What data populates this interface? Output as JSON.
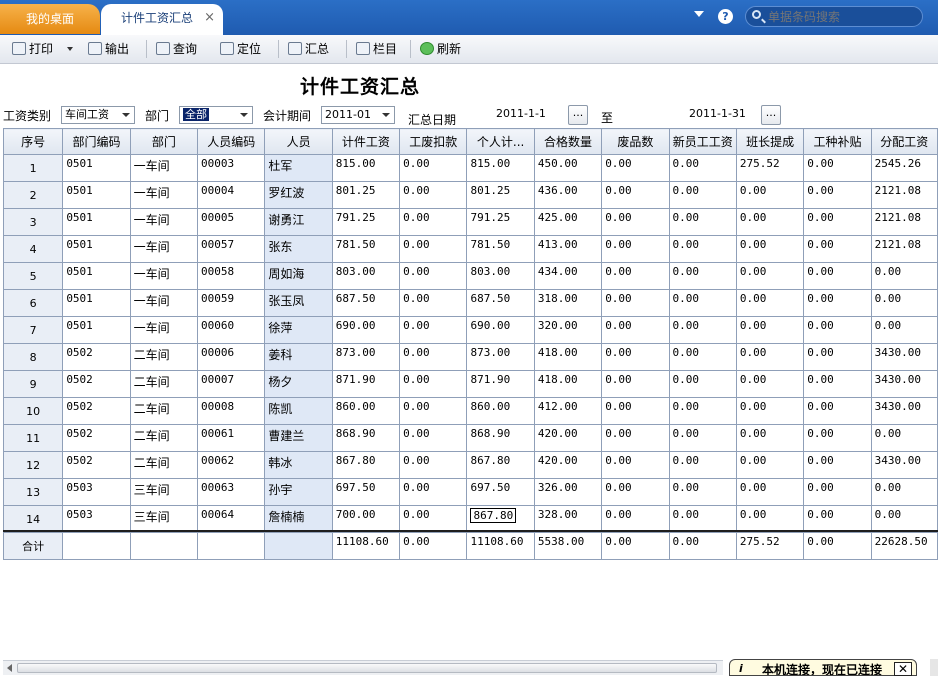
{
  "tabs": [
    {
      "label": "我的桌面"
    },
    {
      "label": "计件工资汇总",
      "close": "×"
    }
  ],
  "header": {
    "help": "?",
    "search_placeholder": "单据条码搜索"
  },
  "toolbar": {
    "print": "打印",
    "export": "输出",
    "query": "查询",
    "locate": "定位",
    "summary": "汇总",
    "columns": "栏目",
    "refresh": "刷新"
  },
  "report_title": "计件工资汇总",
  "filters": {
    "wage_type_label": "工资类别",
    "wage_type_value": "车间工资",
    "dept_label": "部门",
    "dept_value": "全部",
    "period_label": "会计期间",
    "period_value": "2011-01",
    "date_label": "汇总日期",
    "date_from": "2011-1-1",
    "to_label": "至",
    "date_to": "2011-1-31",
    "browse": "..."
  },
  "columns": [
    "序号",
    "部门编码",
    "部门",
    "人员编码",
    "人员",
    "计件工资",
    "工废扣款",
    "个人计...",
    "合格数量",
    "废品数",
    "新员工工资",
    "班长提成",
    "工种补贴",
    "分配工资"
  ],
  "rows": [
    [
      "1",
      "0501",
      "一车间",
      "00003",
      "杜军",
      "815.00",
      "0.00",
      "815.00",
      "450.00",
      "0.00",
      "0.00",
      "275.52",
      "0.00",
      "2545.26"
    ],
    [
      "2",
      "0501",
      "一车间",
      "00004",
      "罗红波",
      "801.25",
      "0.00",
      "801.25",
      "436.00",
      "0.00",
      "0.00",
      "0.00",
      "0.00",
      "2121.08"
    ],
    [
      "3",
      "0501",
      "一车间",
      "00005",
      "谢勇江",
      "791.25",
      "0.00",
      "791.25",
      "425.00",
      "0.00",
      "0.00",
      "0.00",
      "0.00",
      "2121.08"
    ],
    [
      "4",
      "0501",
      "一车间",
      "00057",
      "张东",
      "781.50",
      "0.00",
      "781.50",
      "413.00",
      "0.00",
      "0.00",
      "0.00",
      "0.00",
      "2121.08"
    ],
    [
      "5",
      "0501",
      "一车间",
      "00058",
      "周如海",
      "803.00",
      "0.00",
      "803.00",
      "434.00",
      "0.00",
      "0.00",
      "0.00",
      "0.00",
      "0.00"
    ],
    [
      "6",
      "0501",
      "一车间",
      "00059",
      "张玉凤",
      "687.50",
      "0.00",
      "687.50",
      "318.00",
      "0.00",
      "0.00",
      "0.00",
      "0.00",
      "0.00"
    ],
    [
      "7",
      "0501",
      "一车间",
      "00060",
      "徐萍",
      "690.00",
      "0.00",
      "690.00",
      "320.00",
      "0.00",
      "0.00",
      "0.00",
      "0.00",
      "0.00"
    ],
    [
      "8",
      "0502",
      "二车间",
      "00006",
      "姜科",
      "873.00",
      "0.00",
      "873.00",
      "418.00",
      "0.00",
      "0.00",
      "0.00",
      "0.00",
      "3430.00"
    ],
    [
      "9",
      "0502",
      "二车间",
      "00007",
      "杨夕",
      "871.90",
      "0.00",
      "871.90",
      "418.00",
      "0.00",
      "0.00",
      "0.00",
      "0.00",
      "3430.00"
    ],
    [
      "10",
      "0502",
      "二车间",
      "00008",
      "陈凯",
      "860.00",
      "0.00",
      "860.00",
      "412.00",
      "0.00",
      "0.00",
      "0.00",
      "0.00",
      "3430.00"
    ],
    [
      "11",
      "0502",
      "二车间",
      "00061",
      "曹建兰",
      "868.90",
      "0.00",
      "868.90",
      "420.00",
      "0.00",
      "0.00",
      "0.00",
      "0.00",
      "0.00"
    ],
    [
      "12",
      "0502",
      "二车间",
      "00062",
      "韩冰",
      "867.80",
      "0.00",
      "867.80",
      "420.00",
      "0.00",
      "0.00",
      "0.00",
      "0.00",
      "3430.00"
    ],
    [
      "13",
      "0503",
      "三车间",
      "00063",
      "孙宇",
      "697.50",
      "0.00",
      "697.50",
      "326.00",
      "0.00",
      "0.00",
      "0.00",
      "0.00",
      "0.00"
    ],
    [
      "14",
      "0503",
      "三车间",
      "00064",
      "詹楠楠",
      "700.00",
      "0.00",
      "867.80",
      "328.00",
      "0.00",
      "0.00",
      "0.00",
      "0.00",
      "0.00"
    ]
  ],
  "total_row": [
    "合计",
    "",
    "",
    "",
    "",
    "11108.60",
    "0.00",
    "11108.60",
    "5538.00",
    "0.00",
    "0.00",
    "275.52",
    "0.00",
    "22628.50"
  ],
  "status": {
    "info_icon": "i",
    "message": "本机连接，现在已连接",
    "close": "✕"
  }
}
